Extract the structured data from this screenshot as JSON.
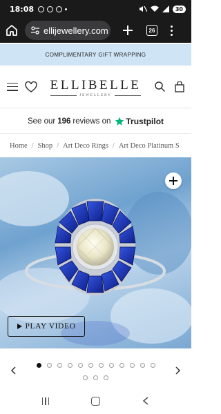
{
  "status_bar": {
    "time": "18:08",
    "battery": "30"
  },
  "browser": {
    "url": "ellijewellery.com",
    "tab_count": "26"
  },
  "promo": {
    "text": "COMPLIMENTARY GIFT WRAPPING"
  },
  "header": {
    "logo": "ELLIBELLE",
    "logo_sub": "JEWELLERY"
  },
  "trust": {
    "prefix": "See our",
    "count": "196",
    "suffix": "reviews on",
    "brand": "Trustpilot",
    "star_color": "#00b67a"
  },
  "breadcrumb": [
    "Home",
    "Shop",
    "Art Deco Rings",
    "Art Deco Platinum S"
  ],
  "product": {
    "play_label": "PLAY VIDEO"
  },
  "carousel": {
    "row1_count": 12,
    "row2_count": 3,
    "active_index": 0
  },
  "colors": {
    "promo_bg": "#cfe4f5",
    "sapphire": "#1f3bb8",
    "browser_bg": "#1a1a1a"
  },
  "icons": [
    "home-icon",
    "site-info-icon",
    "plus-icon",
    "tabs-icon",
    "menu-icon",
    "hamburger-icon",
    "heart-icon",
    "search-icon",
    "bag-icon",
    "trustpilot-star-icon",
    "zoom-plus-icon",
    "play-icon",
    "chevron-left-icon",
    "chevron-right-icon"
  ]
}
